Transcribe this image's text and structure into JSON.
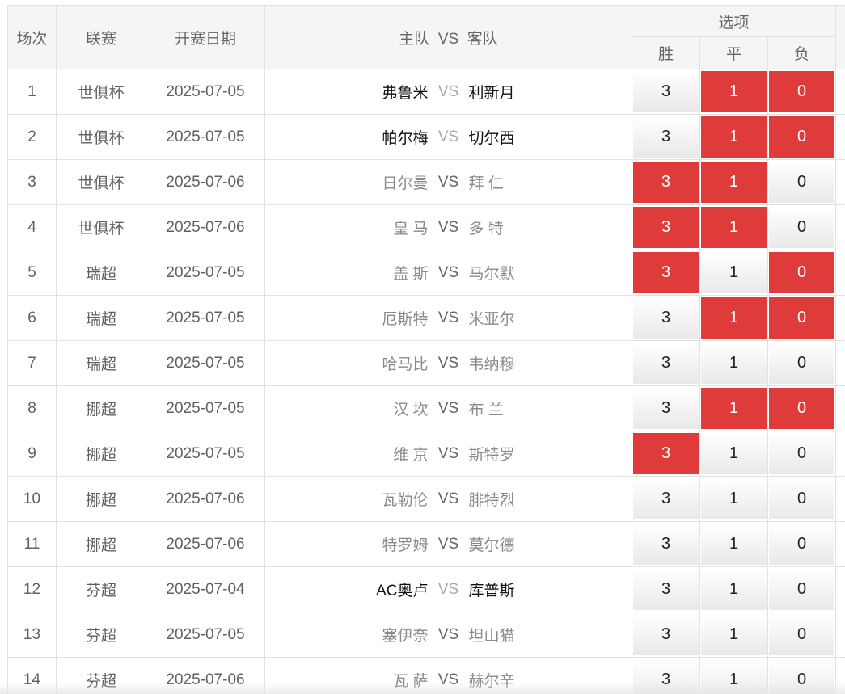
{
  "headers": {
    "index": "场次",
    "league": "联赛",
    "date": "开赛日期",
    "match": "主队  VS  客队",
    "options": "选项",
    "win": "胜",
    "draw": "平",
    "loss": "负"
  },
  "vs_label": "VS",
  "colors": {
    "selected": "#e03b3b",
    "unselected_top": "#ffffff",
    "unselected_bottom": "#e9e9e9"
  },
  "rows": [
    {
      "index": "1",
      "league": "世俱杯",
      "date": "2025-07-05",
      "home": "弗鲁米",
      "away": "利新月",
      "active": true,
      "opts": [
        "3",
        "1",
        "0"
      ],
      "selected": [
        false,
        true,
        true
      ]
    },
    {
      "index": "2",
      "league": "世俱杯",
      "date": "2025-07-05",
      "home": "帕尔梅",
      "away": "切尔西",
      "active": true,
      "opts": [
        "3",
        "1",
        "0"
      ],
      "selected": [
        false,
        true,
        true
      ]
    },
    {
      "index": "3",
      "league": "世俱杯",
      "date": "2025-07-06",
      "home": "日尔曼",
      "away": "拜 仁",
      "active": false,
      "opts": [
        "3",
        "1",
        "0"
      ],
      "selected": [
        true,
        true,
        false
      ]
    },
    {
      "index": "4",
      "league": "世俱杯",
      "date": "2025-07-06",
      "home": "皇 马",
      "away": "多 特",
      "active": false,
      "opts": [
        "3",
        "1",
        "0"
      ],
      "selected": [
        true,
        true,
        false
      ]
    },
    {
      "index": "5",
      "league": "瑞超",
      "date": "2025-07-05",
      "home": "盖 斯",
      "away": "马尔默",
      "active": false,
      "opts": [
        "3",
        "1",
        "0"
      ],
      "selected": [
        true,
        false,
        true
      ]
    },
    {
      "index": "6",
      "league": "瑞超",
      "date": "2025-07-05",
      "home": "厄斯特",
      "away": "米亚尔",
      "active": false,
      "opts": [
        "3",
        "1",
        "0"
      ],
      "selected": [
        false,
        true,
        true
      ]
    },
    {
      "index": "7",
      "league": "瑞超",
      "date": "2025-07-05",
      "home": "哈马比",
      "away": "韦纳穆",
      "active": false,
      "opts": [
        "3",
        "1",
        "0"
      ],
      "selected": [
        false,
        false,
        false
      ]
    },
    {
      "index": "8",
      "league": "挪超",
      "date": "2025-07-05",
      "home": "汉 坎",
      "away": "布 兰",
      "active": false,
      "opts": [
        "3",
        "1",
        "0"
      ],
      "selected": [
        false,
        true,
        true
      ]
    },
    {
      "index": "9",
      "league": "挪超",
      "date": "2025-07-05",
      "home": "维 京",
      "away": "斯特罗",
      "active": false,
      "opts": [
        "3",
        "1",
        "0"
      ],
      "selected": [
        true,
        false,
        false
      ]
    },
    {
      "index": "10",
      "league": "挪超",
      "date": "2025-07-06",
      "home": "瓦勒伦",
      "away": "腓特烈",
      "active": false,
      "opts": [
        "3",
        "1",
        "0"
      ],
      "selected": [
        false,
        false,
        false
      ]
    },
    {
      "index": "11",
      "league": "挪超",
      "date": "2025-07-06",
      "home": "特罗姆",
      "away": "莫尔德",
      "active": false,
      "opts": [
        "3",
        "1",
        "0"
      ],
      "selected": [
        false,
        false,
        false
      ]
    },
    {
      "index": "12",
      "league": "芬超",
      "date": "2025-07-04",
      "home": "AC奥卢",
      "away": "库普斯",
      "active": true,
      "opts": [
        "3",
        "1",
        "0"
      ],
      "selected": [
        false,
        false,
        false
      ]
    },
    {
      "index": "13",
      "league": "芬超",
      "date": "2025-07-05",
      "home": "塞伊奈",
      "away": "坦山猫",
      "active": false,
      "opts": [
        "3",
        "1",
        "0"
      ],
      "selected": [
        false,
        false,
        false
      ]
    },
    {
      "index": "14",
      "league": "芬超",
      "date": "2025-07-06",
      "home": "瓦 萨",
      "away": "赫尔辛",
      "active": false,
      "opts": [
        "3",
        "1",
        "0"
      ],
      "selected": [
        false,
        false,
        false
      ]
    }
  ]
}
